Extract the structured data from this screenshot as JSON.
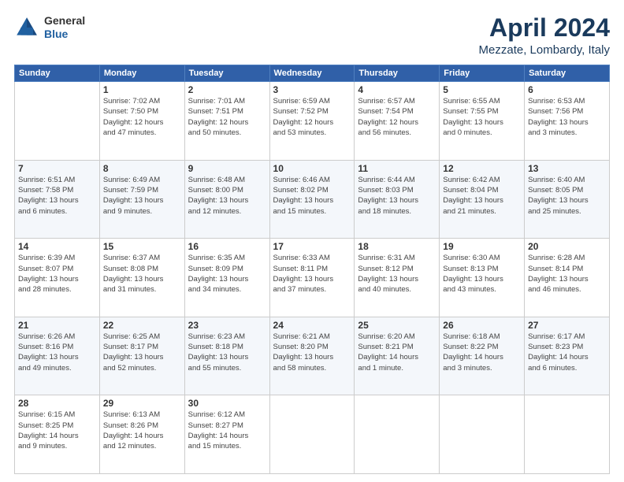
{
  "header": {
    "logo_general": "General",
    "logo_blue": "Blue",
    "title": "April 2024",
    "subtitle": "Mezzate, Lombardy, Italy"
  },
  "weekdays": [
    "Sunday",
    "Monday",
    "Tuesday",
    "Wednesday",
    "Thursday",
    "Friday",
    "Saturday"
  ],
  "weeks": [
    [
      {
        "day": "",
        "info": ""
      },
      {
        "day": "1",
        "info": "Sunrise: 7:02 AM\nSunset: 7:50 PM\nDaylight: 12 hours\nand 47 minutes."
      },
      {
        "day": "2",
        "info": "Sunrise: 7:01 AM\nSunset: 7:51 PM\nDaylight: 12 hours\nand 50 minutes."
      },
      {
        "day": "3",
        "info": "Sunrise: 6:59 AM\nSunset: 7:52 PM\nDaylight: 12 hours\nand 53 minutes."
      },
      {
        "day": "4",
        "info": "Sunrise: 6:57 AM\nSunset: 7:54 PM\nDaylight: 12 hours\nand 56 minutes."
      },
      {
        "day": "5",
        "info": "Sunrise: 6:55 AM\nSunset: 7:55 PM\nDaylight: 13 hours\nand 0 minutes."
      },
      {
        "day": "6",
        "info": "Sunrise: 6:53 AM\nSunset: 7:56 PM\nDaylight: 13 hours\nand 3 minutes."
      }
    ],
    [
      {
        "day": "7",
        "info": "Sunrise: 6:51 AM\nSunset: 7:58 PM\nDaylight: 13 hours\nand 6 minutes."
      },
      {
        "day": "8",
        "info": "Sunrise: 6:49 AM\nSunset: 7:59 PM\nDaylight: 13 hours\nand 9 minutes."
      },
      {
        "day": "9",
        "info": "Sunrise: 6:48 AM\nSunset: 8:00 PM\nDaylight: 13 hours\nand 12 minutes."
      },
      {
        "day": "10",
        "info": "Sunrise: 6:46 AM\nSunset: 8:02 PM\nDaylight: 13 hours\nand 15 minutes."
      },
      {
        "day": "11",
        "info": "Sunrise: 6:44 AM\nSunset: 8:03 PM\nDaylight: 13 hours\nand 18 minutes."
      },
      {
        "day": "12",
        "info": "Sunrise: 6:42 AM\nSunset: 8:04 PM\nDaylight: 13 hours\nand 21 minutes."
      },
      {
        "day": "13",
        "info": "Sunrise: 6:40 AM\nSunset: 8:05 PM\nDaylight: 13 hours\nand 25 minutes."
      }
    ],
    [
      {
        "day": "14",
        "info": "Sunrise: 6:39 AM\nSunset: 8:07 PM\nDaylight: 13 hours\nand 28 minutes."
      },
      {
        "day": "15",
        "info": "Sunrise: 6:37 AM\nSunset: 8:08 PM\nDaylight: 13 hours\nand 31 minutes."
      },
      {
        "day": "16",
        "info": "Sunrise: 6:35 AM\nSunset: 8:09 PM\nDaylight: 13 hours\nand 34 minutes."
      },
      {
        "day": "17",
        "info": "Sunrise: 6:33 AM\nSunset: 8:11 PM\nDaylight: 13 hours\nand 37 minutes."
      },
      {
        "day": "18",
        "info": "Sunrise: 6:31 AM\nSunset: 8:12 PM\nDaylight: 13 hours\nand 40 minutes."
      },
      {
        "day": "19",
        "info": "Sunrise: 6:30 AM\nSunset: 8:13 PM\nDaylight: 13 hours\nand 43 minutes."
      },
      {
        "day": "20",
        "info": "Sunrise: 6:28 AM\nSunset: 8:14 PM\nDaylight: 13 hours\nand 46 minutes."
      }
    ],
    [
      {
        "day": "21",
        "info": "Sunrise: 6:26 AM\nSunset: 8:16 PM\nDaylight: 13 hours\nand 49 minutes."
      },
      {
        "day": "22",
        "info": "Sunrise: 6:25 AM\nSunset: 8:17 PM\nDaylight: 13 hours\nand 52 minutes."
      },
      {
        "day": "23",
        "info": "Sunrise: 6:23 AM\nSunset: 8:18 PM\nDaylight: 13 hours\nand 55 minutes."
      },
      {
        "day": "24",
        "info": "Sunrise: 6:21 AM\nSunset: 8:20 PM\nDaylight: 13 hours\nand 58 minutes."
      },
      {
        "day": "25",
        "info": "Sunrise: 6:20 AM\nSunset: 8:21 PM\nDaylight: 14 hours\nand 1 minute."
      },
      {
        "day": "26",
        "info": "Sunrise: 6:18 AM\nSunset: 8:22 PM\nDaylight: 14 hours\nand 3 minutes."
      },
      {
        "day": "27",
        "info": "Sunrise: 6:17 AM\nSunset: 8:23 PM\nDaylight: 14 hours\nand 6 minutes."
      }
    ],
    [
      {
        "day": "28",
        "info": "Sunrise: 6:15 AM\nSunset: 8:25 PM\nDaylight: 14 hours\nand 9 minutes."
      },
      {
        "day": "29",
        "info": "Sunrise: 6:13 AM\nSunset: 8:26 PM\nDaylight: 14 hours\nand 12 minutes."
      },
      {
        "day": "30",
        "info": "Sunrise: 6:12 AM\nSunset: 8:27 PM\nDaylight: 14 hours\nand 15 minutes."
      },
      {
        "day": "",
        "info": ""
      },
      {
        "day": "",
        "info": ""
      },
      {
        "day": "",
        "info": ""
      },
      {
        "day": "",
        "info": ""
      }
    ]
  ]
}
